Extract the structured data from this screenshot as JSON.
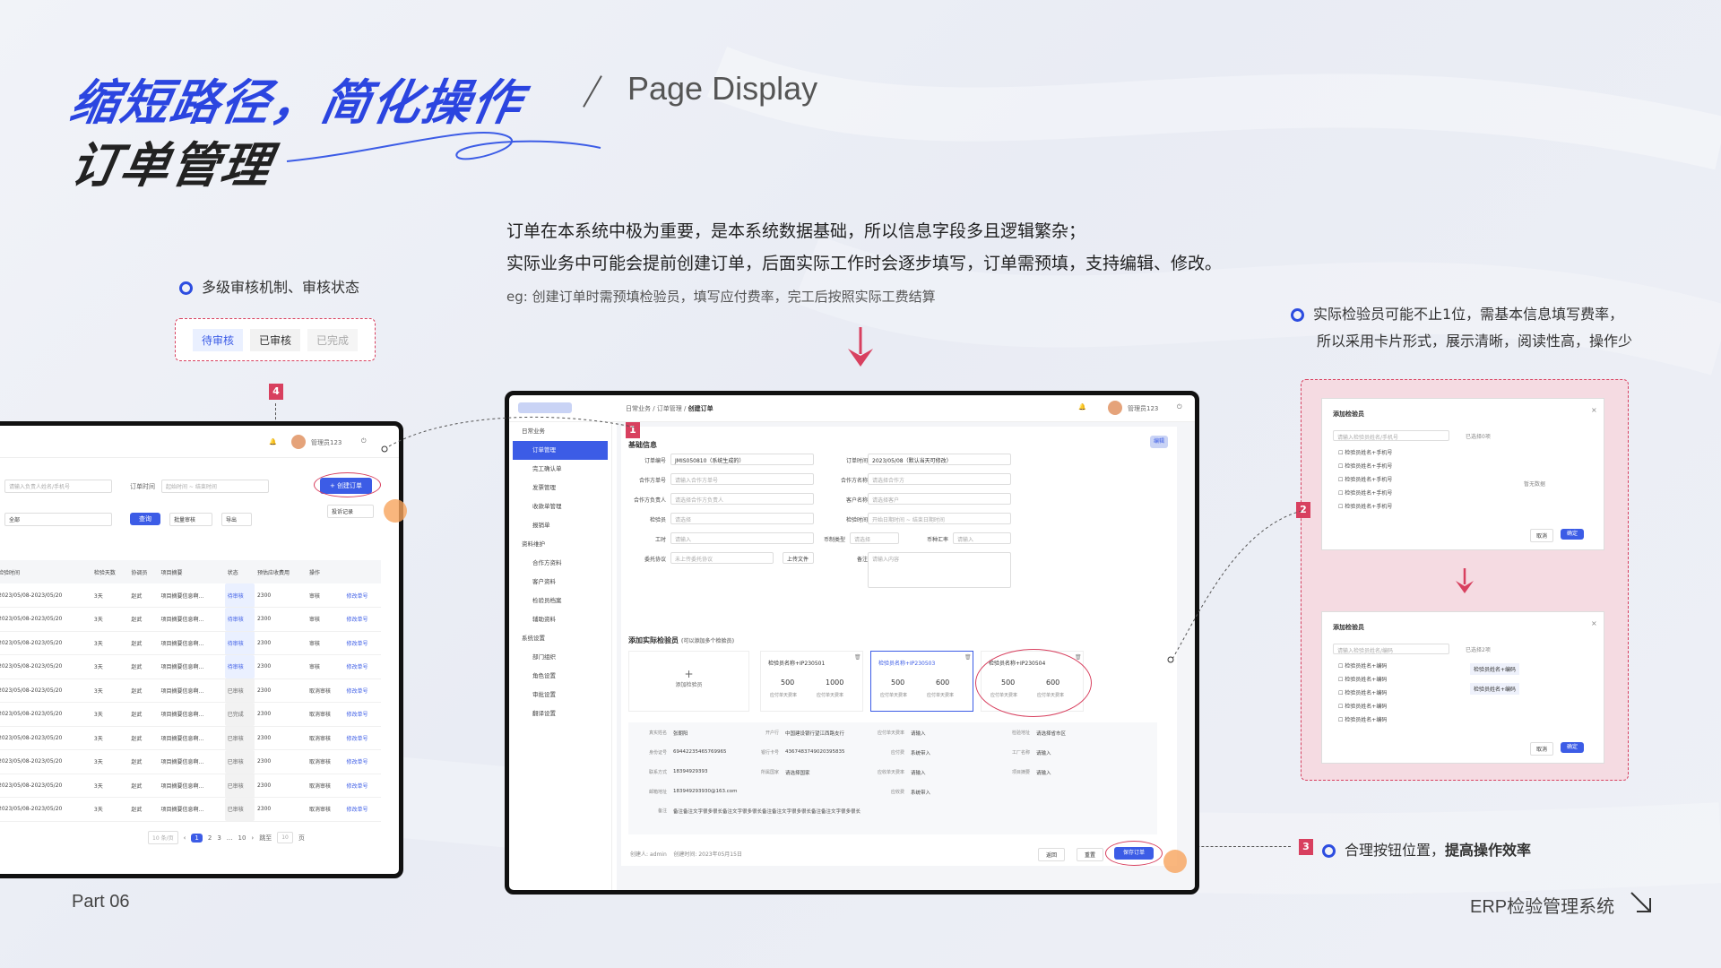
{
  "header": {
    "title_line1": "缩短路径，简化操作",
    "title_line2": "订单管理",
    "subtitle": "Page Display"
  },
  "intro": {
    "line1": "订单在本系统中极为重要，是本系统数据基础，所以信息字段多且逻辑繁杂；",
    "line2": "实际业务中可能会提前创建订单，后面实际工作时会逐步填写，订单需预填，支持编辑、修改。",
    "eg": "eg: 创建订单时需预填检验员，填写应付费率，完工后按照实际工费结算"
  },
  "notes": {
    "n1": "多级审核机制、审核状态",
    "n2_line1": "实际检验员可能不止1位，需基本信息填写费率，",
    "n2_line2": "所以采用卡片形式，展示清晰，阅读性高，操作少",
    "n3_prefix": "合理按钮位置，",
    "n3_bold": "提高操作效率"
  },
  "badges": {
    "b1": "1",
    "b2": "2",
    "b3": "3",
    "b4": "4"
  },
  "status_tabs": [
    "待审核",
    "已审核",
    "已完成"
  ],
  "footer": {
    "left": "Part 06",
    "right": "ERP检验管理系统"
  },
  "list_window": {
    "user": "管理员123",
    "search_placeholder": "请输入负责人姓名/手机号",
    "order_time_label": "订单时间",
    "start_ph": "起始时间",
    "end_ph": "结束时间",
    "filter_all": "全部",
    "query": "查询",
    "batch": "批量审核",
    "export": "导出",
    "create": "+ 创建订单",
    "record": "投诉记录",
    "columns": [
      "检验时间",
      "检验天数",
      "协调员",
      "项目摘要",
      "状态",
      "预估应收费用",
      "操作"
    ],
    "rows": [
      {
        "time": "2023/05/08-2023/05/20",
        "days": "3天",
        "coord": "赵武",
        "summary": "项目摘要信息啊...",
        "status": "待审核",
        "fee": "2300",
        "op": "审核",
        "edit": "修改单号"
      },
      {
        "time": "2023/05/08-2023/05/20",
        "days": "3天",
        "coord": "赵武",
        "summary": "项目摘要信息啊...",
        "status": "待审核",
        "fee": "2300",
        "op": "审核",
        "edit": "修改单号"
      },
      {
        "time": "2023/05/08-2023/05/20",
        "days": "3天",
        "coord": "赵武",
        "summary": "项目摘要信息啊...",
        "status": "待审核",
        "fee": "2300",
        "op": "审核",
        "edit": "修改单号"
      },
      {
        "time": "2023/05/08-2023/05/20",
        "days": "3天",
        "coord": "赵武",
        "summary": "项目摘要信息啊...",
        "status": "待审核",
        "fee": "2300",
        "op": "审核",
        "edit": "修改单号"
      },
      {
        "time": "2023/05/08-2023/05/20",
        "days": "3天",
        "coord": "赵武",
        "summary": "项目摘要信息啊...",
        "status": "已审核",
        "fee": "2300",
        "op": "取消审核",
        "edit": "修改单号"
      },
      {
        "time": "2023/05/08-2023/05/20",
        "days": "3天",
        "coord": "赵武",
        "summary": "项目摘要信息啊...",
        "status": "已完成",
        "fee": "2300",
        "op": "取消审核",
        "edit": "修改单号"
      },
      {
        "time": "2023/05/08-2023/05/20",
        "days": "3天",
        "coord": "赵武",
        "summary": "项目摘要信息啊...",
        "status": "已审核",
        "fee": "2300",
        "op": "取消审核",
        "edit": "修改单号"
      },
      {
        "time": "2023/05/08-2023/05/20",
        "days": "3天",
        "coord": "赵武",
        "summary": "项目摘要信息啊...",
        "status": "已审核",
        "fee": "2300",
        "op": "取消审核",
        "edit": "修改单号"
      },
      {
        "time": "2023/05/08-2023/05/20",
        "days": "3天",
        "coord": "赵武",
        "summary": "项目摘要信息啊...",
        "status": "已审核",
        "fee": "2300",
        "op": "取消审核",
        "edit": "修改单号"
      },
      {
        "time": "2023/05/08-2023/05/20",
        "days": "3天",
        "coord": "赵武",
        "summary": "项目摘要信息啊...",
        "status": "已审核",
        "fee": "2300",
        "op": "取消审核",
        "edit": "修改单号"
      }
    ],
    "pager": {
      "per_page": "10 条/页",
      "pages": [
        "1",
        "2",
        "3",
        "...",
        "10"
      ],
      "goto": "跳至",
      "goto_val": "10",
      "page_unit": "页"
    }
  },
  "main_window": {
    "breadcrumb": [
      "日常业务",
      "订单管理",
      "创建订单"
    ],
    "user": "管理员123",
    "menu": [
      {
        "label": "日常业务",
        "group": true
      },
      {
        "label": "订单管理",
        "active": true
      },
      {
        "label": "完工确认单"
      },
      {
        "label": "发票管理"
      },
      {
        "label": "收款单管理"
      },
      {
        "label": "报销单"
      },
      {
        "label": "资料维护",
        "group": true
      },
      {
        "label": "合作方资料"
      },
      {
        "label": "客户资料"
      },
      {
        "label": "检验员档案"
      },
      {
        "label": "辅助资料"
      },
      {
        "label": "系统设置",
        "group": true
      },
      {
        "label": "部门组织"
      },
      {
        "label": "角色设置"
      },
      {
        "label": "审批设置"
      },
      {
        "label": "翻译设置"
      }
    ],
    "section1": "基础信息",
    "edit_tag": "编辑",
    "form": {
      "order_no_label": "订单编号",
      "order_no": "JMIS050810（系统生成的）",
      "order_time_label": "订单时间",
      "order_time": "2023/05/08（默认当天可修改）",
      "partner_no_label": "合作方单号",
      "partner_no_ph": "请输入合作方单号",
      "partner_label": "合作方名称",
      "partner_ph": "请选择合作方",
      "partner_owner_label": "合作方负责人",
      "partner_owner_ph": "请选择合作方负责人",
      "client_label": "客户名称",
      "client_ph": "请选择客户",
      "inspector_label": "检验员",
      "inspector_ph": "请选择",
      "inspect_time_label": "检验时间",
      "start_ph": "开始日期时间",
      "end_ph": "结束日期时间",
      "hours_label": "工时",
      "hours_ph": "请输入",
      "hours_unit": "天",
      "currency_label": "币制类型",
      "currency_ph": "请选择",
      "rate_label": "币种汇率",
      "rate_ph": "请输入",
      "delegate_label": "委托协议",
      "delegate_ph": "未上传委托协议",
      "upload": "上传文件",
      "remark_label": "备注",
      "remark_ph": "请输入内容",
      "remark_count": "0/50"
    },
    "section2": "添加实际检验员",
    "section2_hint": "(可以添加多个检验员)",
    "add_card": "添加检验员",
    "cards": [
      {
        "name": "检验员名称+IP230501",
        "payable": "500",
        "receivable": "1000",
        "payable_label": "应付单天费率",
        "receivable_label": "应付单天费率"
      },
      {
        "name": "检验员名称+IP230503",
        "payable": "500",
        "receivable": "600",
        "payable_label": "应付单天费率",
        "receivable_label": "应付单天费率"
      },
      {
        "name": "检验员名称+IP230504",
        "payable": "500",
        "receivable": "600",
        "payable_label": "应付单天费率",
        "receivable_label": "应付单天费率"
      }
    ],
    "detail": {
      "real_name_label": "真实姓名",
      "real_name": "张朝阳",
      "bank_label": "开户行",
      "bank": "中国建设银行望江西路支行",
      "id_label": "身份证号",
      "id": "69442235465769965",
      "card_label": "银行卡号",
      "card": "4367483749020395835",
      "contact_label": "联系方式",
      "contact": "18394929393",
      "nation_label": "所属国家",
      "nation_ph": "请选择国家",
      "email_label": "邮箱地址",
      "email": "183949293930@163.com",
      "remark_label": "备注",
      "remark": "备注备注文字很多很长备注文字很多很长备注备注文字很多很长备注备注文字很多很长",
      "pay_rate_label": "应付单天费率",
      "pay_ph": "请输入",
      "cny": "CNY",
      "pay_fee_label": "应付费",
      "pay_fee_ph": "系统带入",
      "rec_rate_label": "应收单天费率",
      "usd": "USD",
      "rec_fee_label": "应收费",
      "insp_addr_label": "检验地址",
      "insp_addr_ph": "请选择省市区",
      "addr_detail_ph": "填写详细地址",
      "factory_label": "工厂名称",
      "factory_ph": "请输入",
      "summary_label": "项目摘要",
      "summary_ph": "请输入",
      "count": "0/50"
    },
    "creator_label": "创建人:",
    "creator": "admin",
    "created_label": "创建时间:",
    "created": "2023年05月15日",
    "back": "返回",
    "reset": "重置",
    "save": "保存订单"
  },
  "dialog": {
    "title": "添加检验员",
    "search_ph": "请输入检验员姓名/手机号",
    "selected0": "已选择0项",
    "empty": "暂无数据",
    "items": [
      "检验员姓名+手机号",
      "检验员姓名+手机号",
      "检验员姓名+手机号",
      "检验员姓名+手机号",
      "检验员姓名+手机号"
    ],
    "cancel": "取消",
    "ok": "确定",
    "search_ph2": "请输入检验员姓名/编码",
    "selected2": "已选择2项",
    "items2": [
      "检验员姓名+编码",
      "检验员姓名+编码",
      "检验员姓名+编码",
      "检验员姓名+编码",
      "检验员姓名+编码"
    ],
    "chosen": [
      "检验员姓名+编码",
      "检验员姓名+编码"
    ]
  }
}
